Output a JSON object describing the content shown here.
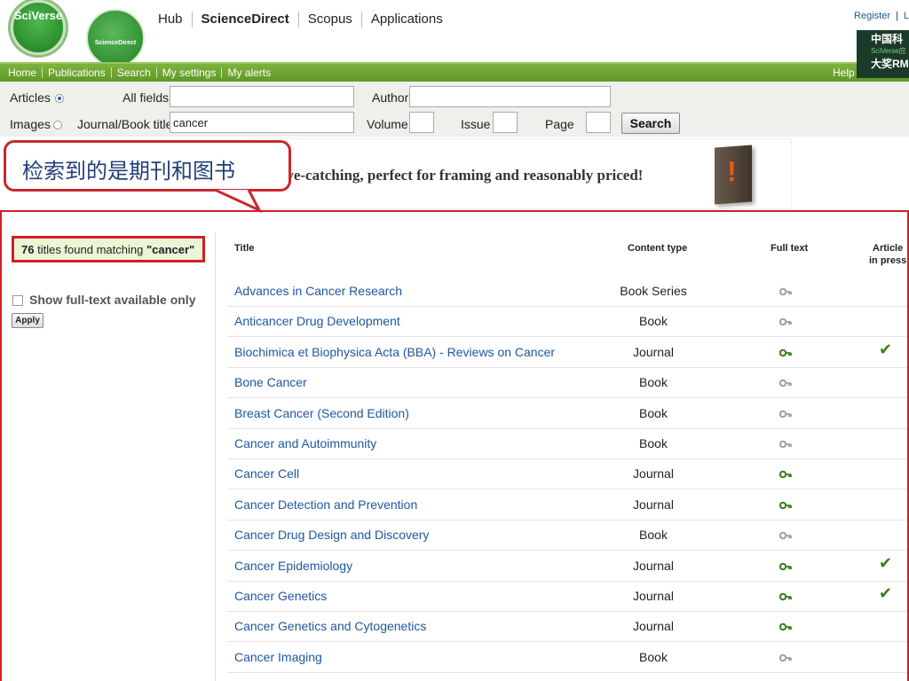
{
  "header": {
    "logo_sciverse": "SciVerse",
    "logo_sciencedirect": "ScienceDirect",
    "nav": [
      {
        "label": "Hub",
        "active": false
      },
      {
        "label": "ScienceDirect",
        "active": true
      },
      {
        "label": "Scopus",
        "active": false
      },
      {
        "label": "Applications",
        "active": false
      }
    ],
    "register_label": "Register",
    "login_label": "L",
    "promo_line1": "中国科",
    "promo_line2": "SciVerse应",
    "promo_line3": "大奖RM"
  },
  "menu": {
    "items": [
      "Home",
      "Publications",
      "Search",
      "My settings",
      "My alerts"
    ],
    "help": "Help"
  },
  "search": {
    "articles_label": "Articles",
    "images_label": "Images",
    "all_fields_label": "All fields",
    "all_fields_value": "",
    "author_label": "Author",
    "author_value": "",
    "journal_label": "Journal/Book title",
    "journal_value": "cancer",
    "volume_label": "Volume",
    "issue_label": "Issue",
    "page_label": "Page",
    "search_button": "Search",
    "selected_scope": "Articles"
  },
  "callout": {
    "text": "检索到的是期刊和图书"
  },
  "banner": {
    "text": "Eye-catching, perfect for framing and reasonably priced!",
    "image_glyph": "!"
  },
  "results": {
    "count": "76",
    "found_text": "titles found matching",
    "query": "\"cancer\"",
    "fulltext_only_label": "Show full-text available only",
    "apply_label": "Apply",
    "columns": {
      "title": "Title",
      "content_type": "Content type",
      "full_text": "Full text",
      "article_in_press_1": "Article",
      "article_in_press_2": "in press"
    },
    "rows": [
      {
        "title": "Advances in Cancer Research",
        "type": "Book Series",
        "full_text": false,
        "in_press": false
      },
      {
        "title": "Anticancer Drug Development",
        "type": "Book",
        "full_text": false,
        "in_press": false
      },
      {
        "title": "Biochimica et Biophysica Acta (BBA) - Reviews on Cancer",
        "type": "Journal",
        "full_text": true,
        "in_press": true
      },
      {
        "title": "Bone Cancer",
        "type": "Book",
        "full_text": false,
        "in_press": false
      },
      {
        "title": "Breast Cancer (Second Edition)",
        "type": "Book",
        "full_text": false,
        "in_press": false
      },
      {
        "title": "Cancer and Autoimmunity",
        "type": "Book",
        "full_text": false,
        "in_press": false
      },
      {
        "title": "Cancer Cell",
        "type": "Journal",
        "full_text": true,
        "in_press": false
      },
      {
        "title": "Cancer Detection and Prevention",
        "type": "Journal",
        "full_text": true,
        "in_press": false
      },
      {
        "title": "Cancer Drug Design and Discovery",
        "type": "Book",
        "full_text": false,
        "in_press": false
      },
      {
        "title": "Cancer Epidemiology",
        "type": "Journal",
        "full_text": true,
        "in_press": true
      },
      {
        "title": "Cancer Genetics",
        "type": "Journal",
        "full_text": true,
        "in_press": true
      },
      {
        "title": "Cancer Genetics and Cytogenetics",
        "type": "Journal",
        "full_text": true,
        "in_press": false
      },
      {
        "title": "Cancer Imaging",
        "type": "Book",
        "full_text": false,
        "in_press": false
      }
    ]
  },
  "colors": {
    "link": "#1f57a0",
    "menu_green": "#6aa62e",
    "highlight_red": "#d01f27",
    "key_available": "#3d7d1e",
    "key_unavailable": "#a0a0a0",
    "check_green": "#3d7d1e"
  },
  "icons": {
    "key_icon": "key-icon",
    "checkmark_icon": "checkmark-icon"
  }
}
